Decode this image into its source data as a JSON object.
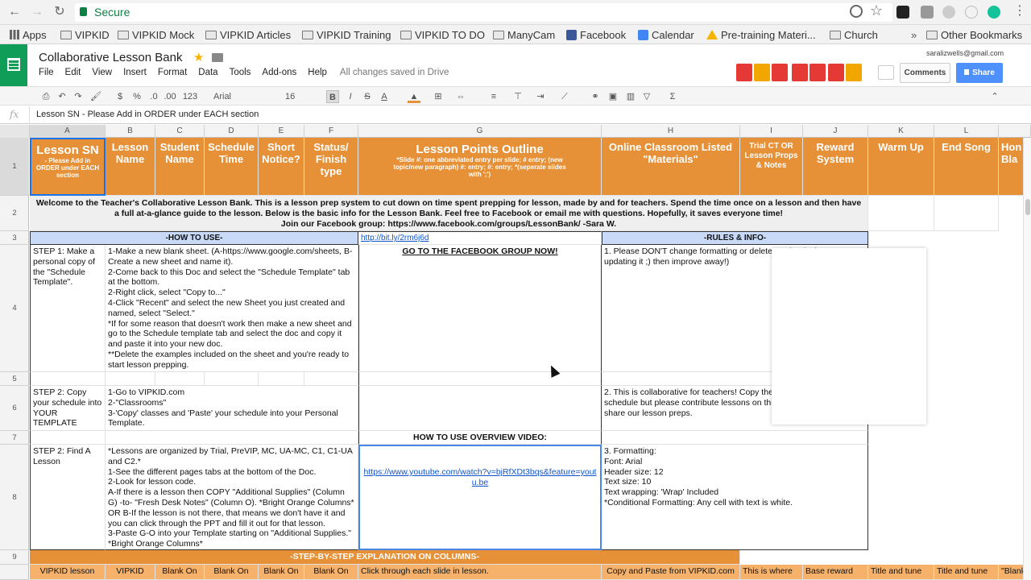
{
  "browser": {
    "secure_label": "Secure",
    "bookmarks": [
      "Apps",
      "VIPKID",
      "VIPKID Mock",
      "VIPKID Articles",
      "VIPKID Training",
      "VIPKID TO DO",
      "ManyCam",
      "Facebook",
      "Calendar",
      "Pre-training Materi...",
      "Church"
    ],
    "overflow": "»",
    "other_bookmarks": "Other Bookmarks"
  },
  "doc": {
    "title": "Collaborative Lesson Bank",
    "menus": [
      "File",
      "Edit",
      "View",
      "Insert",
      "Format",
      "Data",
      "Tools",
      "Add-ons",
      "Help"
    ],
    "save_status": "All changes saved in Drive",
    "account": "saralizwells@gmail.com",
    "comments_label": "Comments",
    "share_label": "Share"
  },
  "toolbar": {
    "currency": "$",
    "percent": "%",
    "dec_less": ".0",
    "dec_more": ".00",
    "more_formats": "123",
    "font": "Arial",
    "size": "16",
    "bold": "B",
    "italic": "I",
    "strike": "S",
    "text_color": "A",
    "sigma": "Σ"
  },
  "formula": {
    "fx": "fx",
    "content": "Lesson SN - Please Add in ORDER under EACH section"
  },
  "columns": [
    "A",
    "B",
    "C",
    "D",
    "E",
    "F",
    "G",
    "H",
    "I",
    "J",
    "K",
    "L"
  ],
  "rows": [
    "1",
    "2",
    "3",
    "4",
    "5",
    "6",
    "7",
    "8",
    "9"
  ],
  "row1": {
    "a_title": "Lesson SN",
    "a_sub": "- Please Add in ORDER under EACH section",
    "b": "Lesson Name",
    "c": "Student Name",
    "d": "Schedule Time",
    "e": "Short Notice?",
    "f": "Status/ Finish type",
    "g_title": "Lesson Points Outline",
    "g_sub": "*Slide #: one abbreviated entry per slide; # entry; (new topic/new paragraph) #: entry; #: entry; *(seperate slides with ';')",
    "h": "Online Classroom Listed \"Materials\"",
    "i": "Trial CT OR Lesson Props & Notes",
    "j": "Reward System",
    "k": "Warm Up",
    "l": "End Song",
    "m": "Hon Bla"
  },
  "row2": {
    "welcome": "Welcome to the Teacher's Collaborative Lesson Bank. This is a lesson prep system to cut down on time spent prepping for lesson, made by and for teachers. Spend the time once on a lesson and then have a full at-a-glance guide to the lesson. Below is the basic info for the Lesson Bank. Feel free to Facebook or email me with questions. Hopefully, it saves everyone time!",
    "join": "Join our Facebook group:  https://www.facebook.com/groups/LessonBank/          -Sara W."
  },
  "row3": {
    "how_to_use": "-HOW TO USE-",
    "link": "http://bit.ly/2rm6j6d",
    "rules": "-RULES & INFO-"
  },
  "row4": {
    "a": "STEP 1: Make a personal copy of the \"Schedule Template\".",
    "b": "1-Make a new blank sheet. (A-https://www.google.com/sheets, B-Create a new sheet and name it).\n2-Come back to this Doc and select the \"Schedule Template\" tab at the bottom.\n2-Right click, select \"Copy to...\"\n4-Click \"Recent\" and select the new Sheet you just created and named, select \"Select.\"\n*If for some reason that doesn't work then make a new sheet and go to the Schedule template tab and select the doc and copy it and paste it into your new doc.\n**Delete the examples included on the sheet and you're ready to start lesson prepping.",
    "g": "GO TO THE FACEBOOK GROUP NOW!",
    "h": "1. Please DON'T change formatting or delete entries (unless you're updating it ;) then improve away!)"
  },
  "row6": {
    "a": "STEP 2: Copy your schedule into YOUR TEMPLATE",
    "b": "1-Go to VIPKID.com\n2-\"Classrooms\"\n3-'Copy' classes and 'Paste' your schedule into your Personal Template.",
    "h": "2. This is collaborative for teachers! Copy the template for your schedule but please contribute lessons on this main Doc, so we all share our lesson preps."
  },
  "row7": {
    "g": "HOW TO USE OVERVIEW VIDEO:"
  },
  "row8": {
    "a": "STEP 2: Find A Lesson",
    "b": "*Lessons are organized by Trial, PreVIP, MC, UA-MC, C1, C1-UA and C2.*\n1-See the different pages tabs at the bottom of the Doc.\n2-Look for lesson code.\nA-If there is a lesson then COPY \"Additional Supplies\" (Column G) -to- \"Fresh Desk Notes\" (Column O). *Bright Orange Columns*\nOR B-If the lesson is not there, that means we don't have it and you can click through the PPT and fill it out for that lesson.\n3-Paste G-O into your Template starting on \"Additional Supplies.\"\n*Bright Orange Columns*",
    "g": "https://www.youtube.com/watch?v=bjRfXDt3bqs&feature=youtu.be",
    "h": "3. Formatting:\nFont: Arial\nHeader size: 12\nText size: 10\nText wrapping: 'Wrap' Included\n*Conditional Formatting: Any cell with text is white."
  },
  "row9": {
    "title": "-STEP-BY-STEP EXPLANATION ON COLUMNS-"
  },
  "row10": {
    "a": "VIPKID lesson",
    "b": "VIPKID",
    "c": "Blank On",
    "d": "Blank On",
    "e": "Blank On",
    "f": "Blank On",
    "g": "Click through each slide in lesson.",
    "h": "Copy and Paste from VIPKID.com",
    "i": "This is where",
    "j": "Base reward",
    "k": "Title and tune or",
    "l": "Title and tune or",
    "m": "\"Blank"
  }
}
